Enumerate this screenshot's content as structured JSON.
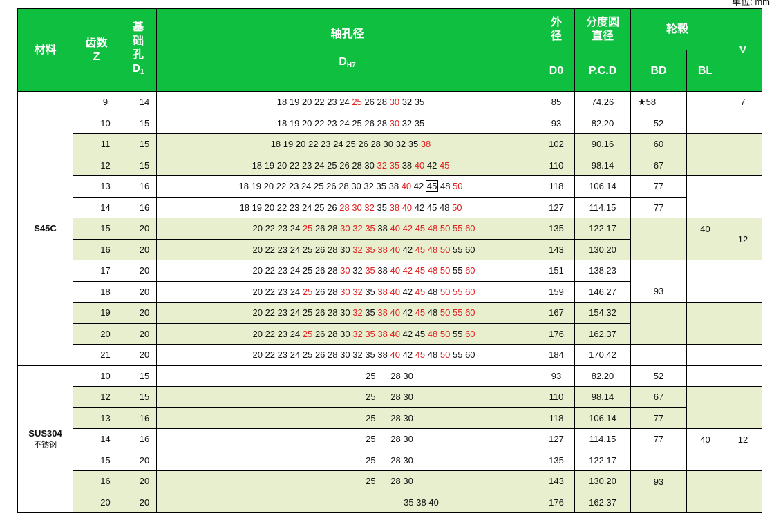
{
  "unit_note": "单位: mm",
  "header": {
    "material": "材料",
    "teeth_line1": "齿数",
    "teeth_line2": "Z",
    "base_line1": "基",
    "base_line2": "础",
    "base_line3": "孔",
    "base_line4": "D",
    "base_sub": "1",
    "bore_line1": "轴孔径",
    "bore_line2": "D",
    "bore_sub": "H7",
    "od_line1": "外",
    "od_line2": "径",
    "od_line3": "D0",
    "pcd_line1": "分度圆",
    "pcd_line2": "直径",
    "pcd_line3": "P.C.D",
    "hub": "轮毂",
    "bd": "BD",
    "bl": "BL",
    "v": "V"
  },
  "materials": {
    "s45c": "S45C",
    "sus304": "SUS304",
    "sus304_sub": "不锈钢"
  },
  "merged": {
    "s45c_bl": "40",
    "s45c_v_top": "7",
    "s45c_v_mid": "12",
    "s45c_bd_93": "93",
    "sus_bl": "40",
    "sus_v": "12",
    "sus_bd_93": "93"
  },
  "rows_s45c": [
    {
      "z": "9",
      "d1": "14",
      "d0": "85",
      "pcd": "74.26",
      "bd": "★58",
      "indent": 0,
      "bores": [
        [
          "18",
          0
        ],
        [
          "19",
          0
        ],
        [
          "20",
          0
        ],
        [
          "22",
          0
        ],
        [
          "23",
          0
        ],
        [
          "24",
          0
        ],
        [
          "25",
          1
        ],
        [
          "26",
          0
        ],
        [
          "28",
          0
        ],
        [
          "30",
          1
        ],
        [
          "32",
          0
        ],
        [
          "35",
          0
        ]
      ]
    },
    {
      "z": "10",
      "d1": "15",
      "d0": "93",
      "pcd": "82.20",
      "bd": "52",
      "indent": 0,
      "bores": [
        [
          "18",
          0
        ],
        [
          "19",
          0
        ],
        [
          "20",
          0
        ],
        [
          "22",
          0
        ],
        [
          "23",
          0
        ],
        [
          "24",
          0
        ],
        [
          "25",
          0
        ],
        [
          "26",
          0
        ],
        [
          "28",
          0
        ],
        [
          "30",
          1
        ],
        [
          "32",
          0
        ],
        [
          "35",
          0
        ]
      ]
    },
    {
      "z": "11",
      "d1": "15",
      "d0": "102",
      "pcd": "90.16",
      "bd": "60",
      "indent": 0,
      "shade": true,
      "bores": [
        [
          "18",
          0
        ],
        [
          "19",
          0
        ],
        [
          "20",
          0
        ],
        [
          "22",
          0
        ],
        [
          "23",
          0
        ],
        [
          "24",
          0
        ],
        [
          "25",
          0
        ],
        [
          "26",
          0
        ],
        [
          "28",
          0
        ],
        [
          "30",
          0
        ],
        [
          "32",
          0
        ],
        [
          "35",
          0
        ],
        [
          "38",
          1
        ]
      ]
    },
    {
      "z": "12",
      "d1": "15",
      "d0": "110",
      "pcd": "98.14",
      "bd": "67",
      "indent": 0,
      "shade": true,
      "bores": [
        [
          "18",
          0
        ],
        [
          "19",
          0
        ],
        [
          "20",
          0
        ],
        [
          "22",
          0
        ],
        [
          "23",
          0
        ],
        [
          "24",
          0
        ],
        [
          "25",
          0
        ],
        [
          "26",
          0
        ],
        [
          "28",
          0
        ],
        [
          "30",
          0
        ],
        [
          "32",
          1
        ],
        [
          "35",
          1
        ],
        [
          "38",
          0
        ],
        [
          "40",
          1
        ],
        [
          "42",
          0
        ],
        [
          "45",
          1
        ]
      ]
    },
    {
      "z": "13",
      "d1": "16",
      "d0": "118",
      "pcd": "106.14",
      "bd": "77",
      "indent": 0,
      "bores": [
        [
          "18",
          0
        ],
        [
          "19",
          0
        ],
        [
          "20",
          0
        ],
        [
          "22",
          0
        ],
        [
          "23",
          0
        ],
        [
          "24",
          0
        ],
        [
          "25",
          0
        ],
        [
          "26",
          0
        ],
        [
          "28",
          0
        ],
        [
          "30",
          0
        ],
        [
          "32",
          0
        ],
        [
          "35",
          0
        ],
        [
          "38",
          0
        ],
        [
          "40",
          1
        ],
        [
          "42",
          0
        ],
        [
          "45",
          2
        ],
        [
          "48",
          0
        ],
        [
          "50",
          1
        ]
      ]
    },
    {
      "z": "14",
      "d1": "16",
      "d0": "127",
      "pcd": "114.15",
      "bd": "77",
      "indent": 0,
      "bores": [
        [
          "18",
          0
        ],
        [
          "19",
          0
        ],
        [
          "20",
          0
        ],
        [
          "22",
          0
        ],
        [
          "23",
          0
        ],
        [
          "24",
          0
        ],
        [
          "25",
          0
        ],
        [
          "26",
          0
        ],
        [
          "28",
          1
        ],
        [
          "30",
          1
        ],
        [
          "32",
          1
        ],
        [
          "35",
          0
        ],
        [
          "38",
          1
        ],
        [
          "40",
          1
        ],
        [
          "42",
          0
        ],
        [
          "45",
          0
        ],
        [
          "48",
          0
        ],
        [
          "50",
          1
        ]
      ]
    },
    {
      "z": "15",
      "d1": "20",
      "d0": "135",
      "pcd": "122.17",
      "bd": "",
      "indent": 1,
      "shade": true,
      "bores": [
        [
          "20",
          0
        ],
        [
          "22",
          0
        ],
        [
          "23",
          0
        ],
        [
          "24",
          0
        ],
        [
          "25",
          1
        ],
        [
          "26",
          0
        ],
        [
          "28",
          0
        ],
        [
          "30",
          1
        ],
        [
          "32",
          1
        ],
        [
          "35",
          1
        ],
        [
          "38",
          0
        ],
        [
          "40",
          1
        ],
        [
          "42",
          1
        ],
        [
          "45",
          1
        ],
        [
          "48",
          1
        ],
        [
          "50",
          1
        ],
        [
          "55",
          1
        ],
        [
          "60",
          1
        ]
      ]
    },
    {
      "z": "16",
      "d1": "20",
      "d0": "143",
      "pcd": "130.20",
      "bd": "",
      "indent": 1,
      "shade": true,
      "bores": [
        [
          "20",
          0
        ],
        [
          "22",
          0
        ],
        [
          "23",
          0
        ],
        [
          "24",
          0
        ],
        [
          "25",
          0
        ],
        [
          "26",
          0
        ],
        [
          "28",
          0
        ],
        [
          "30",
          0
        ],
        [
          "32",
          1
        ],
        [
          "35",
          1
        ],
        [
          "38",
          1
        ],
        [
          "40",
          1
        ],
        [
          "42",
          0
        ],
        [
          "45",
          1
        ],
        [
          "48",
          1
        ],
        [
          "50",
          1
        ],
        [
          "55",
          0
        ],
        [
          "60",
          0
        ]
      ]
    },
    {
      "z": "17",
      "d1": "20",
      "d0": "151",
      "pcd": "138.23",
      "indent": 1,
      "bores": [
        [
          "20",
          0
        ],
        [
          "22",
          0
        ],
        [
          "23",
          0
        ],
        [
          "24",
          0
        ],
        [
          "25",
          0
        ],
        [
          "26",
          0
        ],
        [
          "28",
          0
        ],
        [
          "30",
          1
        ],
        [
          "32",
          0
        ],
        [
          "35",
          1
        ],
        [
          "38",
          0
        ],
        [
          "40",
          1
        ],
        [
          "42",
          1
        ],
        [
          "45",
          1
        ],
        [
          "48",
          1
        ],
        [
          "50",
          1
        ],
        [
          "55",
          0
        ],
        [
          "60",
          1
        ]
      ]
    },
    {
      "z": "18",
      "d1": "20",
      "d0": "159",
      "pcd": "146.27",
      "indent": 1,
      "bores": [
        [
          "20",
          0
        ],
        [
          "22",
          0
        ],
        [
          "23",
          0
        ],
        [
          "24",
          0
        ],
        [
          "25",
          1
        ],
        [
          "26",
          0
        ],
        [
          "28",
          0
        ],
        [
          "30",
          1
        ],
        [
          "32",
          1
        ],
        [
          "35",
          0
        ],
        [
          "38",
          1
        ],
        [
          "40",
          1
        ],
        [
          "42",
          0
        ],
        [
          "45",
          1
        ],
        [
          "48",
          0
        ],
        [
          "50",
          1
        ],
        [
          "55",
          1
        ],
        [
          "60",
          1
        ]
      ]
    },
    {
      "z": "19",
      "d1": "20",
      "d0": "167",
      "pcd": "154.32",
      "indent": 1,
      "shade": true,
      "bores": [
        [
          "20",
          0
        ],
        [
          "22",
          0
        ],
        [
          "23",
          0
        ],
        [
          "24",
          0
        ],
        [
          "25",
          0
        ],
        [
          "26",
          0
        ],
        [
          "28",
          0
        ],
        [
          "30",
          0
        ],
        [
          "32",
          1
        ],
        [
          "35",
          0
        ],
        [
          "38",
          1
        ],
        [
          "40",
          1
        ],
        [
          "42",
          0
        ],
        [
          "45",
          1
        ],
        [
          "48",
          0
        ],
        [
          "50",
          1
        ],
        [
          "55",
          1
        ],
        [
          "60",
          1
        ]
      ]
    },
    {
      "z": "20",
      "d1": "20",
      "d0": "176",
      "pcd": "162.37",
      "indent": 1,
      "shade": true,
      "bores": [
        [
          "20",
          0
        ],
        [
          "22",
          0
        ],
        [
          "23",
          0
        ],
        [
          "24",
          0
        ],
        [
          "25",
          1
        ],
        [
          "26",
          0
        ],
        [
          "28",
          0
        ],
        [
          "30",
          0
        ],
        [
          "32",
          1
        ],
        [
          "35",
          1
        ],
        [
          "38",
          1
        ],
        [
          "40",
          1
        ],
        [
          "42",
          0
        ],
        [
          "45",
          0
        ],
        [
          "48",
          1
        ],
        [
          "50",
          1
        ],
        [
          "55",
          0
        ],
        [
          "60",
          1
        ]
      ]
    },
    {
      "z": "21",
      "d1": "20",
      "d0": "184",
      "pcd": "170.42",
      "bd": "",
      "indent": 1,
      "bores": [
        [
          "20",
          0
        ],
        [
          "22",
          0
        ],
        [
          "23",
          0
        ],
        [
          "24",
          0
        ],
        [
          "25",
          0
        ],
        [
          "26",
          0
        ],
        [
          "28",
          0
        ],
        [
          "30",
          0
        ],
        [
          "32",
          0
        ],
        [
          "35",
          0
        ],
        [
          "38",
          0
        ],
        [
          "40",
          1
        ],
        [
          "42",
          0
        ],
        [
          "45",
          1
        ],
        [
          "48",
          0
        ],
        [
          "50",
          1
        ],
        [
          "55",
          0
        ],
        [
          "60",
          0
        ]
      ]
    }
  ],
  "rows_sus": [
    {
      "z": "10",
      "d1": "15",
      "d0": "93",
      "pcd": "82.20",
      "bd": "52",
      "indent": 2,
      "bores": [
        [
          "25",
          0
        ],
        [
          "_",
          0
        ],
        [
          "28",
          0
        ],
        [
          "30",
          0
        ]
      ]
    },
    {
      "z": "12",
      "d1": "15",
      "d0": "110",
      "pcd": "98.14",
      "bd": "67",
      "indent": 2,
      "shade": true,
      "bores": [
        [
          "25",
          0
        ],
        [
          "_",
          0
        ],
        [
          "28",
          0
        ],
        [
          "30",
          0
        ]
      ]
    },
    {
      "z": "13",
      "d1": "16",
      "d0": "118",
      "pcd": "106.14",
      "bd": "77",
      "indent": 2,
      "shade": true,
      "bores": [
        [
          "25",
          0
        ],
        [
          "_",
          0
        ],
        [
          "28",
          0
        ],
        [
          "30",
          0
        ]
      ]
    },
    {
      "z": "14",
      "d1": "16",
      "d0": "127",
      "pcd": "114.15",
      "bd": "77",
      "indent": 2,
      "bores": [
        [
          "25",
          0
        ],
        [
          "_",
          0
        ],
        [
          "28",
          0
        ],
        [
          "30",
          0
        ]
      ]
    },
    {
      "z": "15",
      "d1": "20",
      "d0": "135",
      "pcd": "122.17",
      "bd": "",
      "indent": 2,
      "bores": [
        [
          "25",
          0
        ],
        [
          "_",
          0
        ],
        [
          "28",
          0
        ],
        [
          "30",
          0
        ]
      ]
    },
    {
      "z": "16",
      "d1": "20",
      "d0": "143",
      "pcd": "130.20",
      "indent": 2,
      "shade": true,
      "bores": [
        [
          "25",
          0
        ],
        [
          "_",
          0
        ],
        [
          "28",
          0
        ],
        [
          "30",
          0
        ]
      ]
    },
    {
      "z": "20",
      "d1": "20",
      "d0": "176",
      "pcd": "162.37",
      "indent": 3,
      "shade": true,
      "bores": [
        [
          "35",
          0
        ],
        [
          "38",
          0
        ],
        [
          "40",
          0
        ]
      ]
    }
  ]
}
